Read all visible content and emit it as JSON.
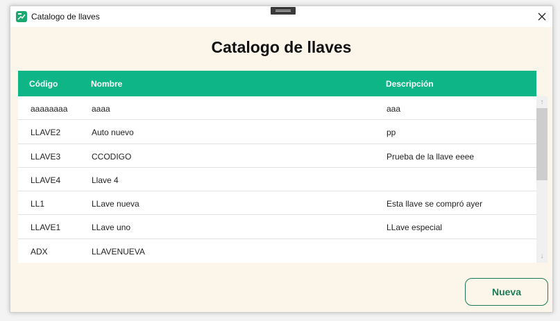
{
  "window": {
    "title": "Catalogo de llaves"
  },
  "heading": "Catalogo de llaves",
  "table": {
    "headers": {
      "codigo": "Código",
      "nombre": "Nombre",
      "descripcion": "Descripción"
    },
    "rows": [
      {
        "codigo": "aaaaaaaa",
        "nombre": "aaaa",
        "descripcion": "aaa"
      },
      {
        "codigo": "LLAVE2",
        "nombre": "Auto nuevo",
        "descripcion": "pp"
      },
      {
        "codigo": "LLAVE3",
        "nombre": "CCODIGO",
        "descripcion": "Prueba de la llave eeee"
      },
      {
        "codigo": "LLAVE4",
        "nombre": "Llave 4",
        "descripcion": ""
      },
      {
        "codigo": "LL1",
        "nombre": "LLave nueva",
        "descripcion": "Esta llave se compró ayer"
      },
      {
        "codigo": "LLAVE1",
        "nombre": "LLave uno",
        "descripcion": "LLave especial"
      },
      {
        "codigo": "ADX",
        "nombre": "LLAVENUEVA",
        "descripcion": ""
      }
    ]
  },
  "buttons": {
    "nueva": "Nueva"
  },
  "colors": {
    "header_bg": "#0db587",
    "window_bg": "#fcf6ea",
    "button_border": "#1c7a58"
  },
  "icons": {
    "app": "key-app-icon",
    "close": "close-icon",
    "scroll_up": "arrow-up-icon",
    "scroll_down": "arrow-down-icon"
  }
}
